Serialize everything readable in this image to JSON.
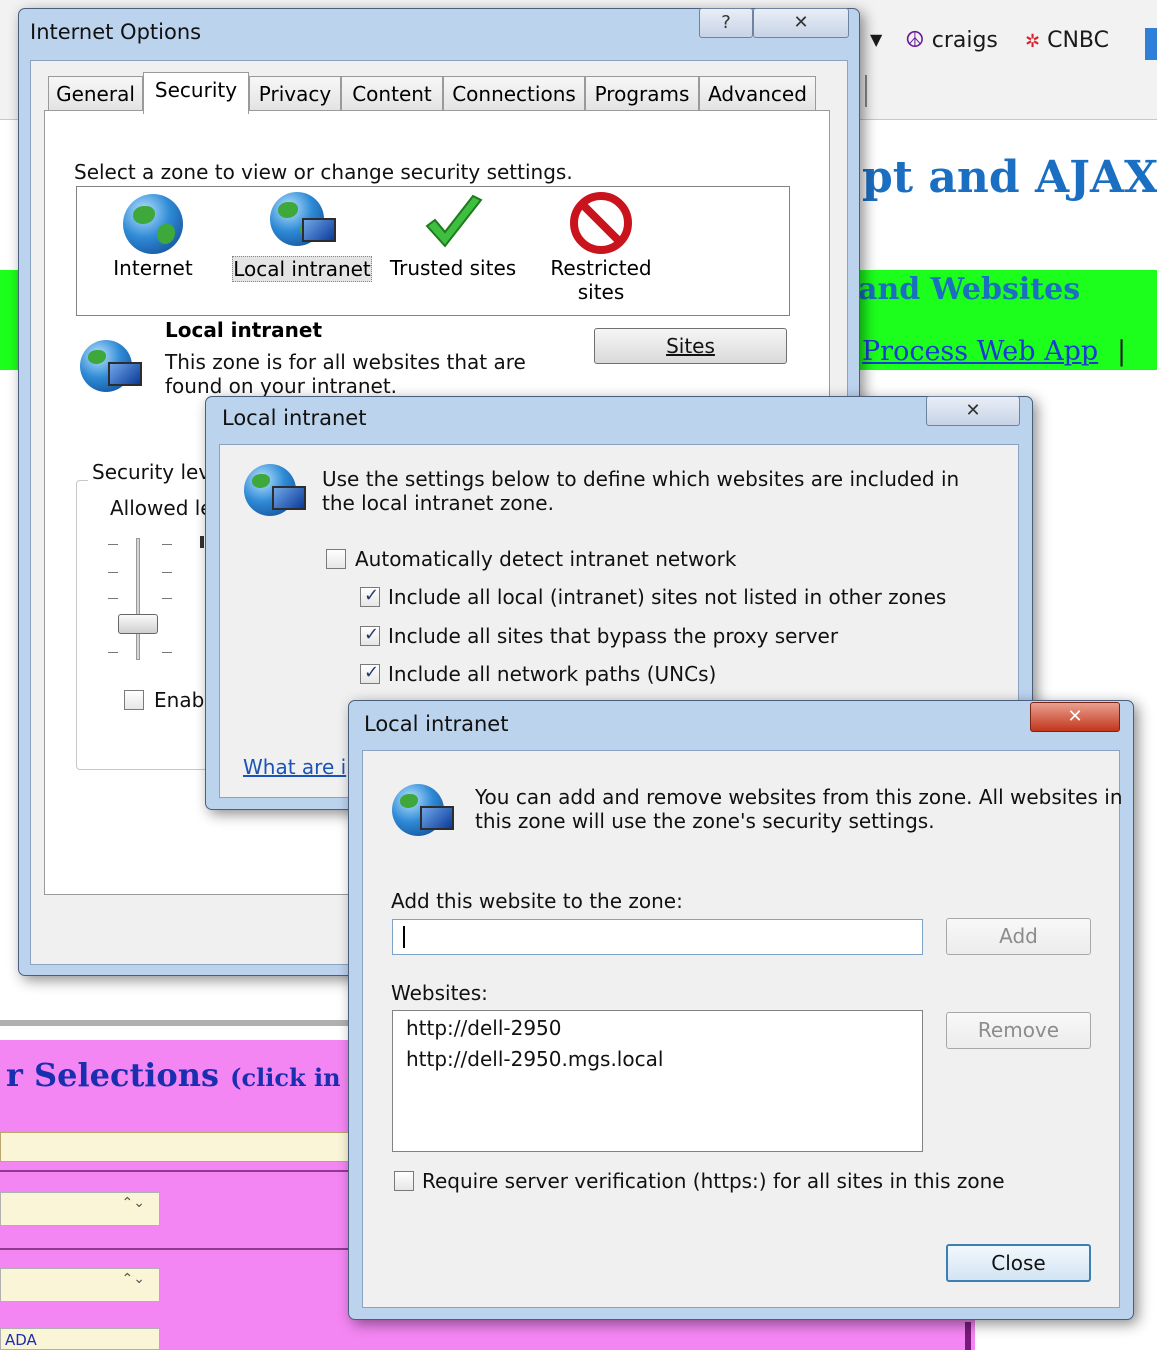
{
  "browser": {
    "favorites": [
      {
        "icon": "peace-icon",
        "label": "craigs"
      },
      {
        "icon": "nbc-peacock-icon",
        "label": "CNBC"
      }
    ],
    "dropdown_arrow": "▼"
  },
  "webpage": {
    "heading_fragment": "pt and AJAX",
    "green_band_heading_fragment": "and Websites",
    "green_band_link_fragment": "Process Web App",
    "green_band_separator": "|",
    "selections_heading_fragment": "r Selections",
    "selections_hint_fragment": "(click in box",
    "field_fragment": "ADA",
    "stepper_arrows": "⌃⌄"
  },
  "internet_options": {
    "title": "Internet Options",
    "help_button": "?",
    "close_button": "✕",
    "tabs": [
      "General",
      "Security",
      "Privacy",
      "Content",
      "Connections",
      "Programs",
      "Advanced"
    ],
    "active_tab": "Security",
    "zone_prompt": "Select a zone to view or change security settings.",
    "zones": [
      {
        "icon": "globe-icon",
        "label": "Internet"
      },
      {
        "icon": "intranet-globe-icon",
        "label": "Local intranet"
      },
      {
        "icon": "checkmark-icon",
        "label": "Trusted sites"
      },
      {
        "icon": "restricted-icon",
        "label": "Restricted",
        "label2": "sites"
      }
    ],
    "selected_zone": "Local intranet",
    "zone_heading": "Local intranet",
    "zone_description_line1": "This zone is for all websites that are",
    "zone_description_line2": "found on your intranet.",
    "sites_button": "Sites",
    "security_level_fragment": "Security lev",
    "allowed_levels_fragment": "Allowed le",
    "enable_fragment": "Enabl"
  },
  "intranet_settings": {
    "title": "Local intranet",
    "close_button": "✕",
    "description_line1": "Use the settings below to define which websites are included in",
    "description_line2": "the local intranet zone.",
    "auto_detect": {
      "label": "Automatically detect intranet network",
      "checked": false
    },
    "options": [
      {
        "label": "Include all local (intranet) sites not listed in other zones",
        "checked": true
      },
      {
        "label": "Include all sites that bypass the proxy server",
        "checked": true
      },
      {
        "label": "Include all network paths (UNCs)",
        "checked": true
      }
    ],
    "what_are_link_fragment": "What are i"
  },
  "intranet_sites": {
    "title": "Local intranet",
    "close_button": "✕",
    "description_line1": "You can add and remove websites from this zone. All websites in",
    "description_line2": "this zone will use the zone's security settings.",
    "add_label": "Add this website to the zone:",
    "add_input_value": "",
    "add_button": "Add",
    "websites_label": "Websites:",
    "websites": [
      "http://dell-2950",
      "http://dell-2950.mgs.local"
    ],
    "remove_button": "Remove",
    "require_https": {
      "label": "Require server verification (https:) for all sites in this zone",
      "checked": false
    },
    "close_label": "Close"
  }
}
